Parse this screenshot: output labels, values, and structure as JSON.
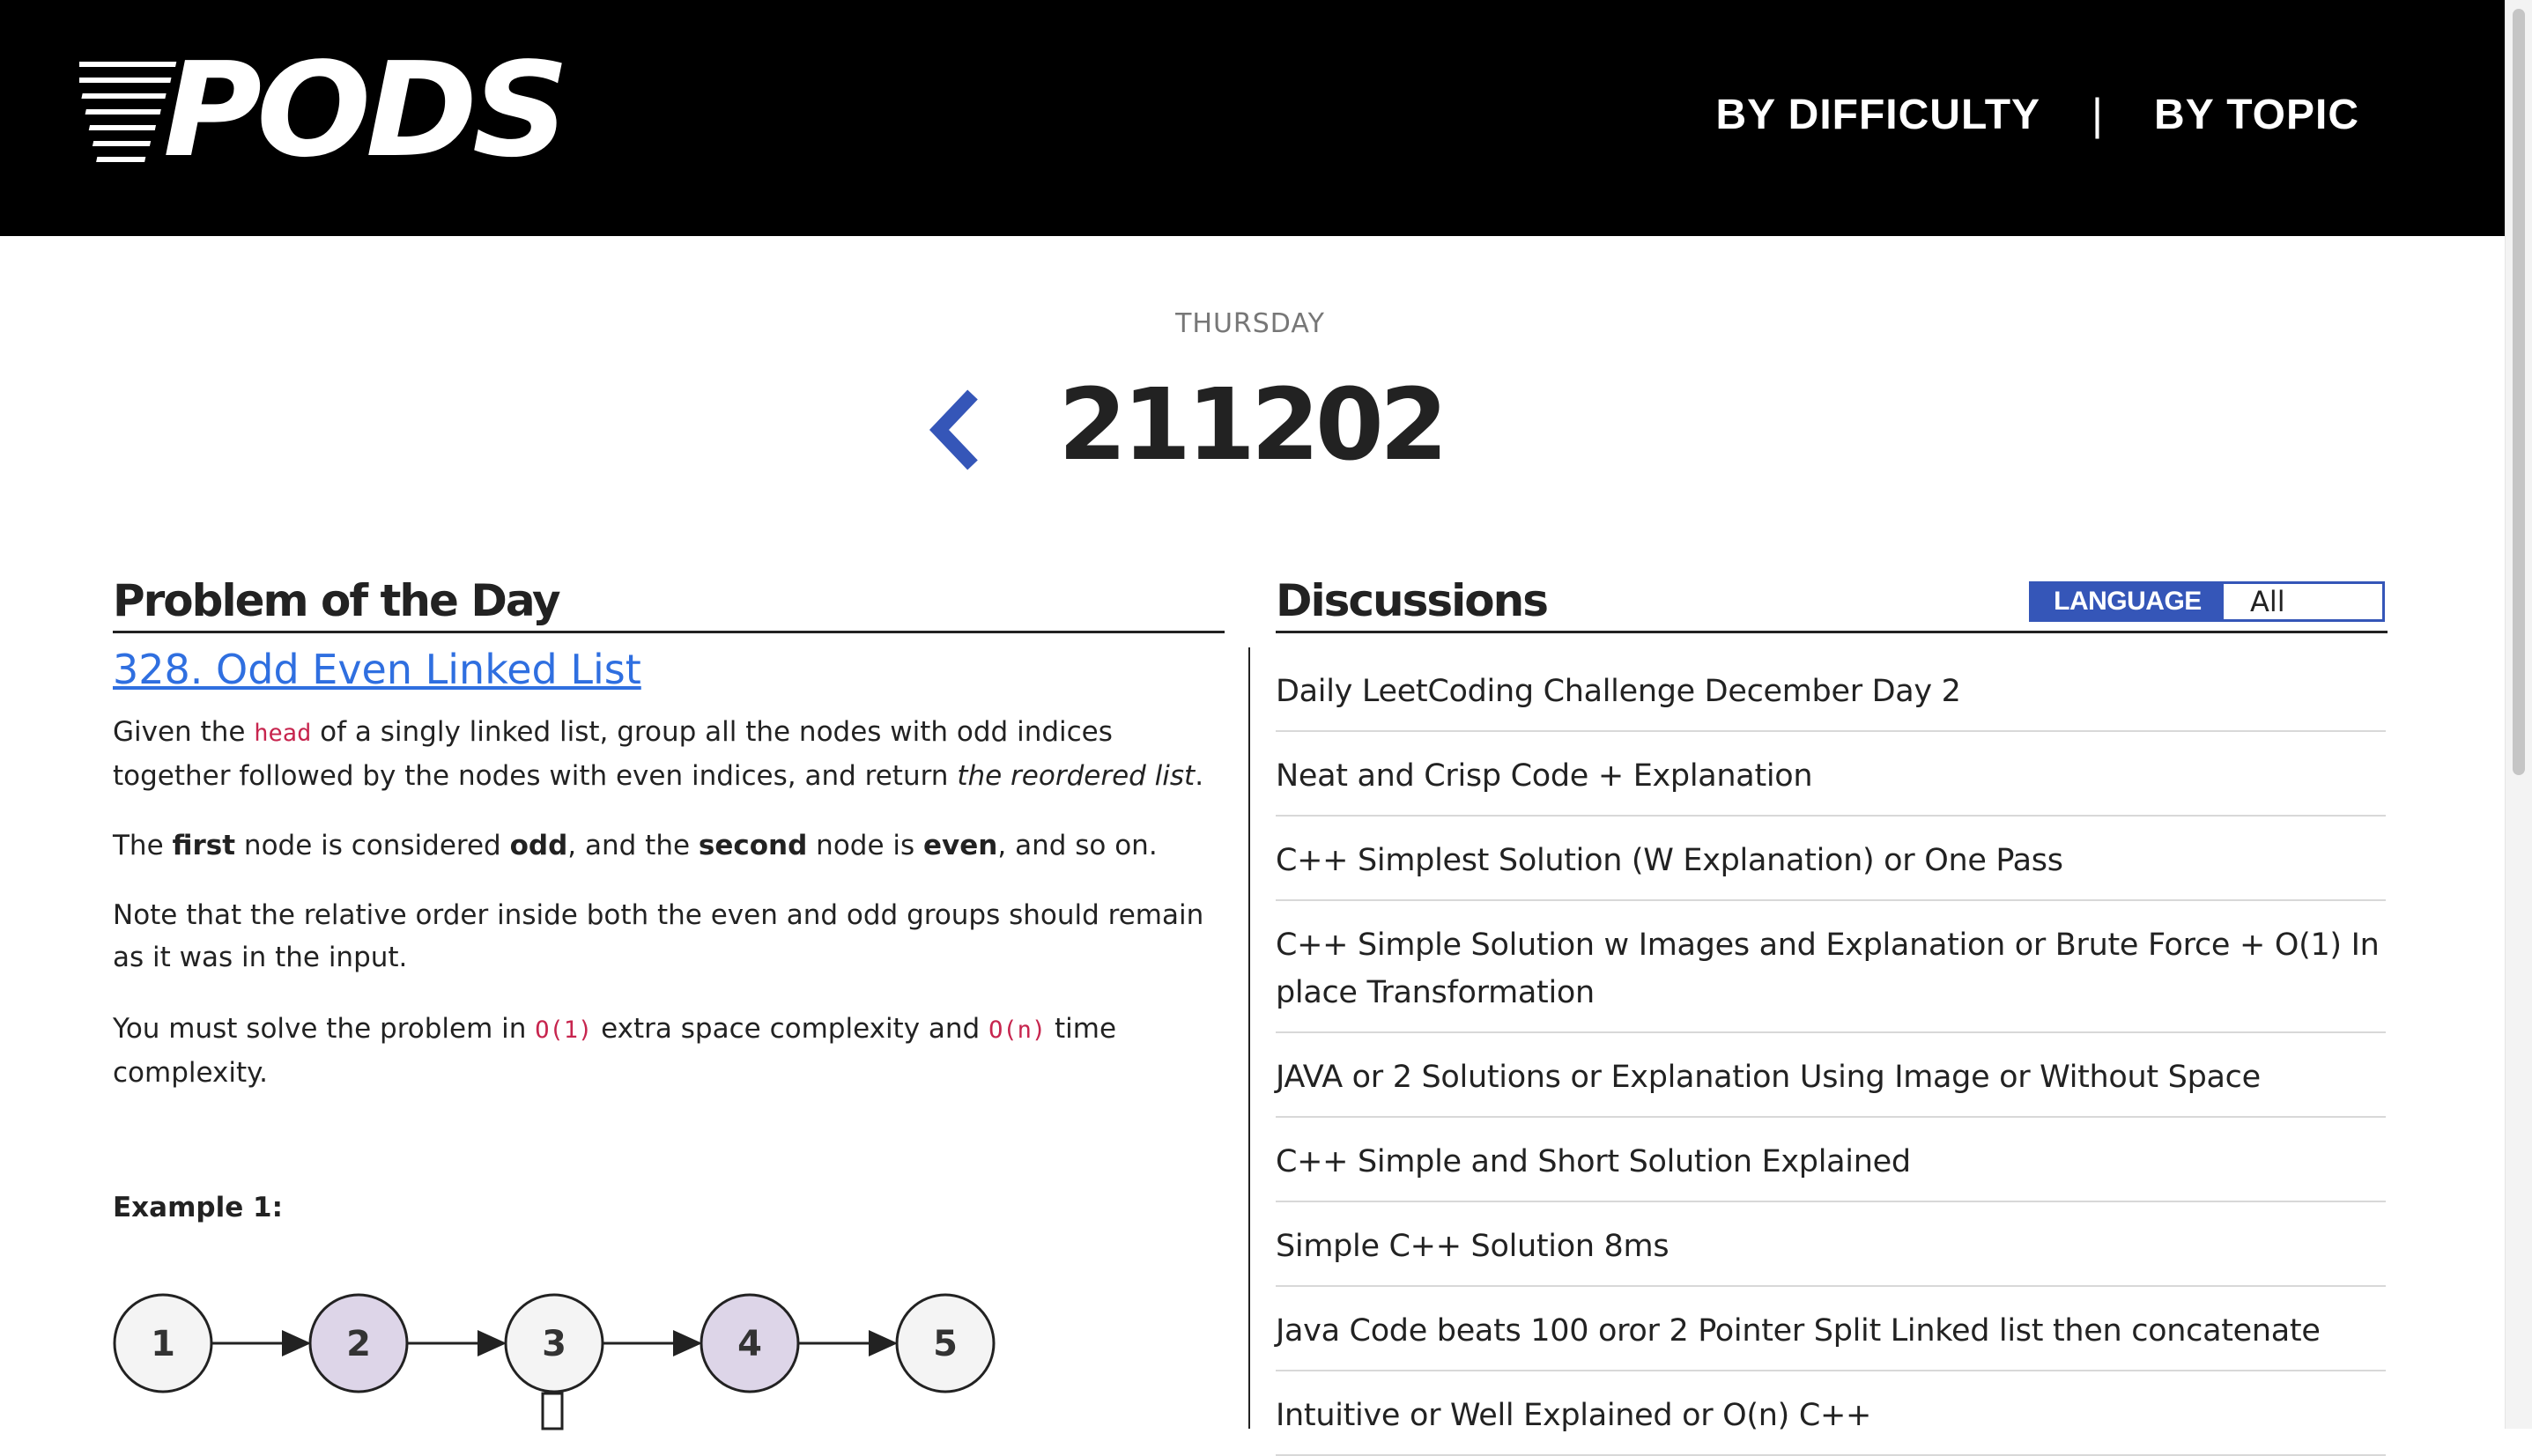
{
  "header": {
    "logo_text": "PODS",
    "nav": [
      "BY DIFFICULTY",
      "BY TOPIC"
    ],
    "nav_separator": "|"
  },
  "date_header": {
    "weekday": "THURSDAY",
    "date": "211202",
    "prev_icon": "chevron-left-icon"
  },
  "problem": {
    "section_title": "Problem of the Day",
    "link_text": "328. Odd Even Linked List",
    "p1": {
      "t1": "Given the ",
      "code1": "head",
      "t2": " of a singly linked list, group all the nodes with odd indices together followed by the nodes with even indices, and return ",
      "em1": "the reordered list",
      "t3": "."
    },
    "p2": {
      "t1": "The ",
      "b1": "first",
      "t2": " node is considered ",
      "b2": "odd",
      "t3": ", and the ",
      "b3": "second",
      "t4": " node is ",
      "b4": "even",
      "t5": ", and so on."
    },
    "p3": "Note that the relative order inside both the even and odd groups should remain as it was in the input.",
    "p4": {
      "t1": "You must solve the problem in ",
      "code1": "O(1)",
      "t2": " extra space complexity and ",
      "code2": "O(n)",
      "t3": " time complexity."
    },
    "example_title": "Example 1:",
    "example_nodes": [
      "1",
      "2",
      "3",
      "4",
      "5"
    ],
    "even_node_color": "#ddd5e8",
    "odd_node_color": "#f4f4f4"
  },
  "discussions": {
    "section_title": "Discussions",
    "language_label": "LANGUAGE",
    "language_value": "All",
    "accent_color": "#3556b8",
    "items": [
      "Daily LeetCoding Challenge December Day 2",
      "Neat and Crisp Code + Explanation",
      "C++ Simplest Solution (W Explanation) or One Pass",
      "C++ Simple Solution w Images and Explanation or Brute Force + O(1) In place Transformation",
      "JAVA or 2 Solutions or Explanation Using Image or Without Space",
      "C++ Simple and Short Solution Explained",
      "Simple C++ Solution 8ms",
      "Java Code beats 100 oror 2 Pointer Split Linked list then concatenate",
      "Intuitive or Well Explained or O(n) C++"
    ]
  }
}
